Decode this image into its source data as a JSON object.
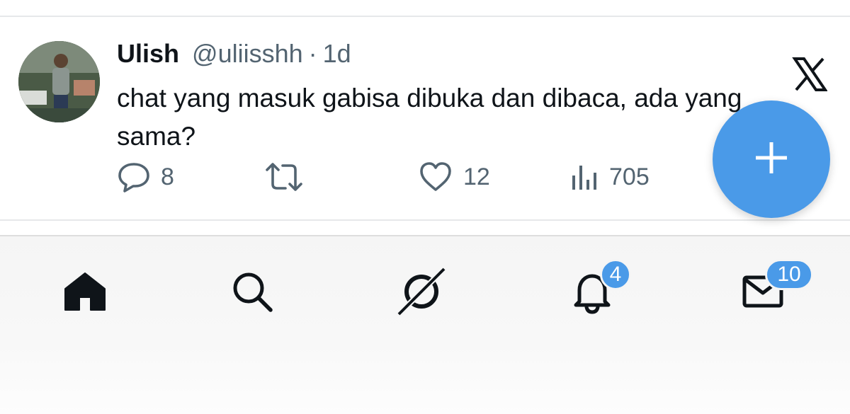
{
  "post": {
    "author_name": "Ulish",
    "handle": "@uliisshh",
    "separator": "·",
    "time": "1d",
    "text": "chat yang masuk gabisa dibuka dan dibaca, ada yang sama?",
    "replies": "8",
    "likes": "12",
    "views": "705",
    "icons": [
      "reply-icon",
      "repost-icon",
      "like-icon",
      "views-icon",
      "x-logo"
    ]
  },
  "fab": {
    "icon": "plus-icon",
    "color": "#4a9ae8"
  },
  "tabbar": {
    "items": [
      {
        "icon": "home-icon"
      },
      {
        "icon": "search-icon"
      },
      {
        "icon": "grok-icon"
      },
      {
        "icon": "bell-icon",
        "badge": "4"
      },
      {
        "icon": "mail-icon",
        "badge": "10"
      }
    ]
  },
  "colors": {
    "accent": "#4a9ae8",
    "text": "#0f1419",
    "muted": "#536471"
  }
}
